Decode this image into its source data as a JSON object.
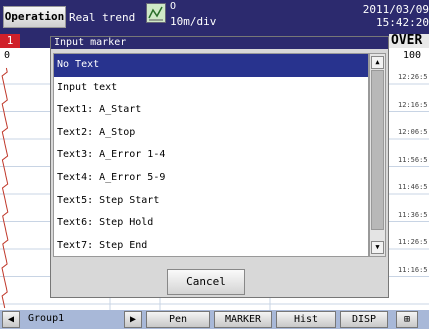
{
  "header": {
    "operation_label": "Operation",
    "mode_label": "Real trend",
    "marker_symbol": "O",
    "time_div": "10m/div",
    "date": "2011/03/09",
    "time": "15:42:20",
    "trend_icon": "trend-graph-icon"
  },
  "status": {
    "group_number": "1",
    "over_label": "OVER"
  },
  "chart": {
    "scale_min": "0",
    "scale_max": "100",
    "time_ticks": [
      "12:26:5",
      "12:16:5",
      "12:06:5",
      "11:56:5",
      "11:46:5",
      "11:36:5",
      "11:26:5",
      "11:16:5"
    ]
  },
  "dialog": {
    "title": "Input marker",
    "items": [
      "No Text",
      "Input text",
      "Text1: A_Start",
      "Text2: A_Stop",
      "Text3: A_Error 1-4",
      "Text4: A_Error 5-9",
      "Text5: Step Start",
      "Text6: Step Hold",
      "Text7: Step End"
    ],
    "selected_index": 0,
    "cancel_label": "Cancel",
    "scroll_up_icon": "▲",
    "scroll_down_icon": "▼"
  },
  "footer": {
    "left_arrow": "◀",
    "group_label": "Group1",
    "right_arrow": "▶",
    "pen_label": "Pen",
    "marker_label": "MARKER",
    "hist_label": "Hist",
    "disp_label": "DISP",
    "grid_icon": "⊞"
  },
  "colors": {
    "title_bar": "#2c2a6e",
    "selection": "#28338e",
    "group_badge": "#d0202a",
    "trend_pen": "#c0392b",
    "bottom_bar": "#a8b8d8"
  }
}
